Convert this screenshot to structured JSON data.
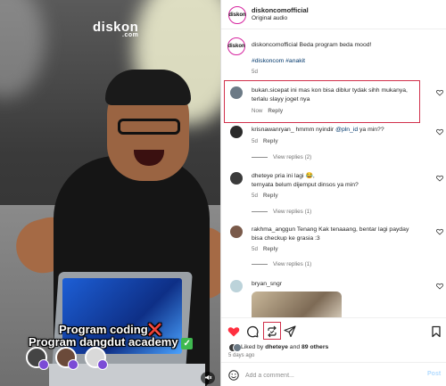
{
  "media": {
    "brand_text": "diskon",
    "brand_sub": ".com",
    "caption_line1": "Program coding",
    "caption_mark1": "❌",
    "caption_line2": "Program dangdut academy",
    "caption_mark2": "✓",
    "sound_icon": "speaker-muted-icon"
  },
  "header": {
    "avatar_text": "diskon",
    "username": "diskoncomofficial",
    "audio": "Original audio"
  },
  "post": {
    "username": "diskoncomofficial",
    "text": "Beda program beda mood!",
    "hashtags": "#diskoncom #anakit",
    "age": "5d"
  },
  "comments": [
    {
      "username": "bukan.sicepat",
      "line1": "ini mas kon bisa diblur tydak sihh mukanya,",
      "line2": "terlalu slayy joget nya",
      "age": "Now",
      "reply": "Reply",
      "view_replies": ""
    },
    {
      "username": "krisnawanryan_",
      "line1": "hmmm nyindir",
      "mention": "@pln_id",
      "line1_after": "ya min??",
      "line2": "",
      "age": "5d",
      "reply": "Reply",
      "view_replies": "View replies (2)"
    },
    {
      "username": "dheteye",
      "line1": "pria ini lagi 😂,",
      "line2": "ternyata belum dijemput dinsos ya min?",
      "age": "5d",
      "reply": "Reply",
      "view_replies": "View replies (1)"
    },
    {
      "username": "rakhma_anggun",
      "line1": "Tenang Kak tenaaang, bentar lagi payday",
      "line2": "bisa checkup ke grasia :3",
      "age": "5d",
      "reply": "Reply",
      "view_replies": "View replies (1)"
    },
    {
      "username": "bryan_sngr",
      "line1": "",
      "line2": "",
      "age": "",
      "reply": "",
      "view_replies": ""
    }
  ],
  "actions": {
    "liked_prefix": "Liked by",
    "liked_user": "dheteye",
    "liked_and": "and",
    "liked_others": "89 others",
    "age": "5 days ago"
  },
  "add_comment": {
    "placeholder": "Add a comment...",
    "post_label": "Post"
  },
  "colors": {
    "like_red": "#ff3040",
    "highlight": "#d1304b",
    "link": "#00376b",
    "post_button": "#b3dbff"
  }
}
